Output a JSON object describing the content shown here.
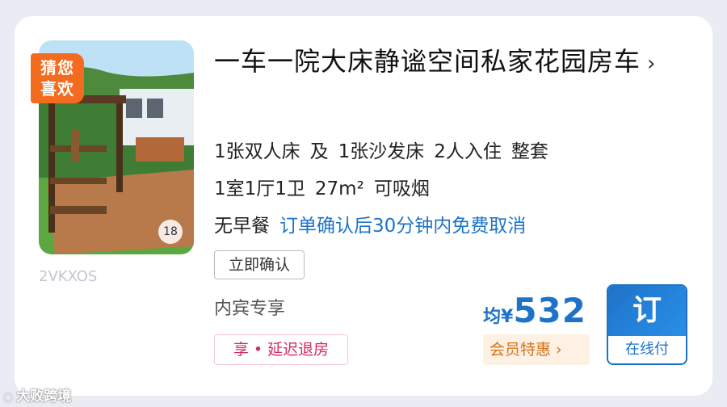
{
  "listing": {
    "badge": "猜您喜欢",
    "badge_line1": "猜您",
    "badge_line2": "喜欢",
    "photo_count": "18",
    "code": "2VKXOS",
    "title": "一车一院大床静谧空间私家花园房车",
    "title_chevron": "›",
    "beds": {
      "bed1": "1张双人床",
      "and": "及",
      "bed2": "1张沙发床",
      "guests": "2人入住",
      "type": "整套"
    },
    "layout": {
      "rooms": "1室1厅1卫",
      "area": "27m²",
      "smoking": "可吸烟"
    },
    "breakfast": "无早餐",
    "cancellation": "订单确认后30分钟内免费取消",
    "tag_confirm": "立即确认",
    "vip_exclusive": "内宾专享",
    "perk": "享 • 延迟退房"
  },
  "price": {
    "prefix": "均",
    "currency": "¥",
    "amount": "532",
    "member_offer": "会员特惠 ›"
  },
  "book": {
    "label": "订",
    "sub_label": "在线付"
  },
  "watermark": {
    "text": "大败跨境"
  },
  "colors": {
    "accent_blue": "#1e73c8",
    "ribbon_orange": "#f36b1e",
    "perk_pink": "#d52a63",
    "member_orange": "#d4741c"
  }
}
